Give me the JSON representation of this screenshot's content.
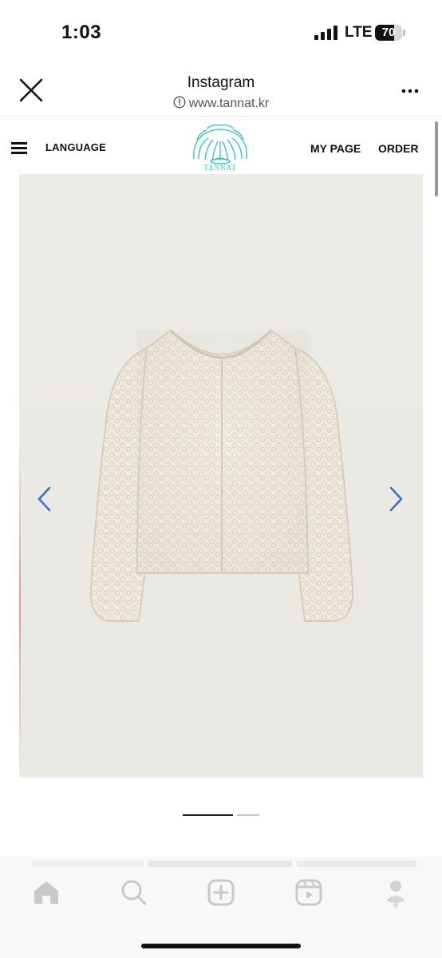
{
  "status_bar": {
    "time": "1:03",
    "network": "LTE",
    "battery_percent": 70,
    "battery_label": "70"
  },
  "browser": {
    "title": "Instagram",
    "url": "www.tannat.kr",
    "close_icon": "close-icon",
    "more_icon": "more-horizontal-icon",
    "info_icon": "info-circle-icon"
  },
  "site_nav": {
    "menu_icon": "hamburger-menu-icon",
    "language_label": "LANGUAGE",
    "logo_text": "TANNAT",
    "mypage_label": "MY PAGE",
    "order_label": "ORDER"
  },
  "product": {
    "image_desc_icon": "product-photo",
    "prev_icon": "chevron-left-icon",
    "next_icon": "chevron-right-icon",
    "slide_count": 2,
    "current_slide": 1
  },
  "colors": {
    "accent_blue": "#2f6fd6",
    "logo_teal": "#36bcc9",
    "pager_active": "#222222",
    "pager_inactive": "#c8c8c8"
  },
  "bottom_tabs": [
    {
      "icon": "home-icon"
    },
    {
      "icon": "search-icon"
    },
    {
      "icon": "create-post-icon"
    },
    {
      "icon": "reels-icon"
    },
    {
      "icon": "profile-icon"
    }
  ]
}
